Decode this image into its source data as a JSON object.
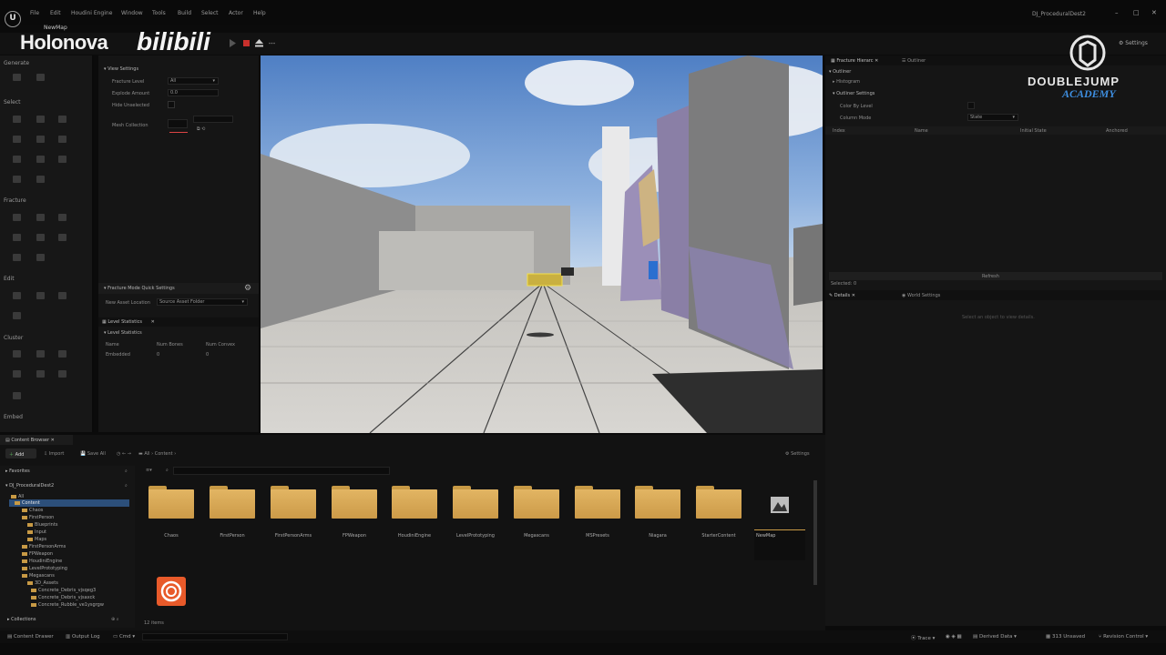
{
  "menubar": {
    "items": [
      "File",
      "Edit",
      "Houdini Engine",
      "Window",
      "Tools",
      "Build",
      "Select",
      "Actor",
      "Help"
    ],
    "project": "DJ_ProceduralDest2",
    "map_tab": "NewMap"
  },
  "overlay": {
    "watermark": "Holonova",
    "site_logo": "bilibili",
    "brand_name": "DOUBLEJUMP",
    "brand_sub": "ACADEMY"
  },
  "toolbar": {
    "settings": "Settings"
  },
  "tool_panel": {
    "sections": [
      "Generate",
      "Select",
      "Fracture",
      "Edit",
      "Cluster",
      "Embed"
    ]
  },
  "fracture_panel": {
    "view_settings_header": "View Settings",
    "rows": [
      {
        "label": "Fracture Level",
        "value": "All"
      },
      {
        "label": "Explode Amount",
        "value": "0.0"
      },
      {
        "label": "Hide Unselected",
        "value": ""
      },
      {
        "label": "Mesh Collection",
        "value": ""
      }
    ],
    "quick_settings_header": "Fracture Mode Quick Settings",
    "new_asset_location_label": "New Asset Location",
    "new_asset_location_value": "Source Asset Folder",
    "level_stats_tab": "Level Statistics",
    "level_stats_header": "Level Statistics",
    "columns": [
      "Name",
      "Num Bones",
      "Num Convex"
    ],
    "row": [
      "Embedded",
      "0",
      "0"
    ]
  },
  "outliner": {
    "tabs": [
      "Fracture Hierarc",
      "Outliner"
    ],
    "tree": [
      "Outliner",
      "Histogram",
      "Outliner Settings"
    ],
    "settings_rows": [
      {
        "label": "Color By Level",
        "value": ""
      },
      {
        "label": "Column Mode",
        "value": "State"
      }
    ],
    "columns": [
      "Index",
      "Name",
      "Initial State",
      "Anchored"
    ],
    "refresh": "Refresh",
    "selected": "Selected: 0"
  },
  "details": {
    "tabs": [
      "Details",
      "World Settings"
    ],
    "empty_msg": "Select an object to view details."
  },
  "content_browser": {
    "tab": "Content Browser",
    "add": "Add",
    "import": "Import",
    "save_all": "Save All",
    "breadcrumb": [
      "All",
      "Content"
    ],
    "settings": "Settings",
    "favorites": "Favorites",
    "project_root": "DJ_ProceduralDest2",
    "tree": [
      "All",
      "Content",
      "Chaos",
      "FirstPerson",
      "Blueprints",
      "Input",
      "Maps",
      "FirstPersonArms",
      "FPWeapon",
      "HoudiniEngine",
      "LevelPrototyping",
      "Megascans",
      "3D_Assets",
      "Concrete_Debris_vjsqeg3",
      "Concrete_Debris_vjsaxck",
      "Concrete_Rubble_ve1ysgrgw"
    ],
    "folders": [
      "Chaos",
      "FirstPerson",
      "FirstPersonArms",
      "FPWeapon",
      "HoudiniEngine",
      "LevelPrototyping",
      "Megascans",
      "MSPresets",
      "Niagara",
      "StarterContent"
    ],
    "map_asset": "NewMap",
    "collections": "Collections",
    "item_count": "12 items"
  },
  "statusbar": {
    "left": [
      "Content Drawer",
      "Output Log",
      "Cmd"
    ],
    "right": [
      "Trace",
      "Derived Data",
      "313 Unsaved",
      "Revision Control"
    ]
  },
  "colors": {
    "folder": "#d9a852",
    "accent_blue": "#3e8ee0",
    "record_red": "#c8302c"
  }
}
